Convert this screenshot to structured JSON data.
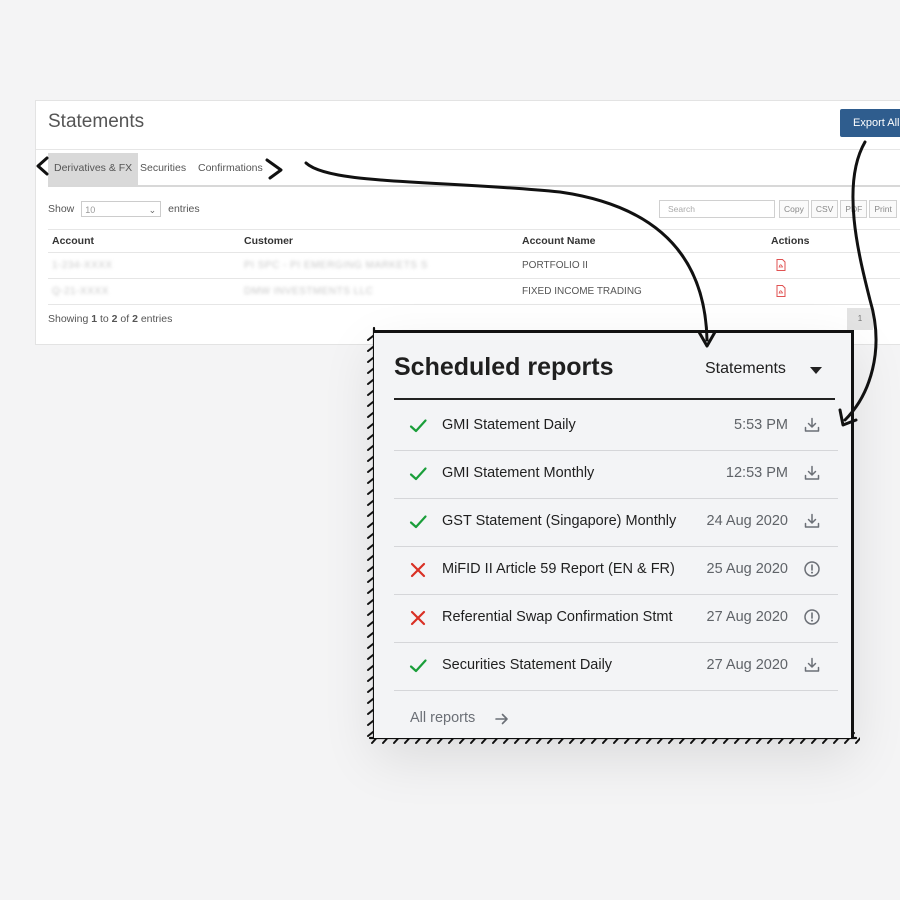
{
  "statements": {
    "title": "Statements",
    "export_label": "Export All",
    "tabs": [
      {
        "label": "Derivatives & FX",
        "active": true
      },
      {
        "label": "Securities",
        "active": false
      },
      {
        "label": "Confirmations",
        "active": false
      }
    ],
    "show_label": "Show",
    "show_value": "10",
    "entries_label": "entries",
    "search_placeholder": "Search",
    "export_buttons": [
      "Copy",
      "CSV",
      "PDF",
      "Print"
    ],
    "columns": [
      "Account",
      "Customer",
      "Account Name",
      "Actions"
    ],
    "rows": [
      {
        "account": "1-234-XXXX",
        "customer": "PI SPC - PI EMERGING MARKETS S",
        "account_name": "PORTFOLIO II",
        "action_icon": "pdf-icon"
      },
      {
        "account": "Q-21-XXXX",
        "customer": "DMW INVESTMENTS LLC",
        "account_name": "FIXED INCOME TRADING",
        "action_icon": "pdf-icon"
      }
    ],
    "showing_text": {
      "prefix": "Showing ",
      "from": "1",
      "to_word": " to ",
      "to": "2",
      "of_word": " of ",
      "total": "2",
      "suffix": " entries"
    },
    "page_number": "1"
  },
  "scheduled": {
    "title": "Scheduled reports",
    "filter_value": "Statements",
    "reports": [
      {
        "name": "GMI Statement Daily",
        "time": "5:53 PM",
        "status": "success",
        "action_icon": "download-icon"
      },
      {
        "name": "GMI Statement Monthly",
        "time": "12:53 PM",
        "status": "success",
        "action_icon": "download-icon"
      },
      {
        "name": "GST Statement (Singapore) Monthly",
        "time": "24 Aug 2020",
        "status": "success",
        "action_icon": "download-icon"
      },
      {
        "name": "MiFID II Article 59 Report (EN & FR)",
        "time": "25 Aug 2020",
        "status": "failed",
        "action_icon": "alert-icon"
      },
      {
        "name": "Referential Swap Confirmation Stmt",
        "time": "27 Aug 2020",
        "status": "failed",
        "action_icon": "alert-icon"
      },
      {
        "name": "Securities Statement Daily",
        "time": "27 Aug 2020",
        "status": "success",
        "action_icon": "download-icon"
      }
    ],
    "all_reports_label": "All reports"
  },
  "colors": {
    "success": "#1a9e3a",
    "failed": "#d93025",
    "export_button": "#2f5d8e",
    "annotation_ink": "#111111"
  }
}
